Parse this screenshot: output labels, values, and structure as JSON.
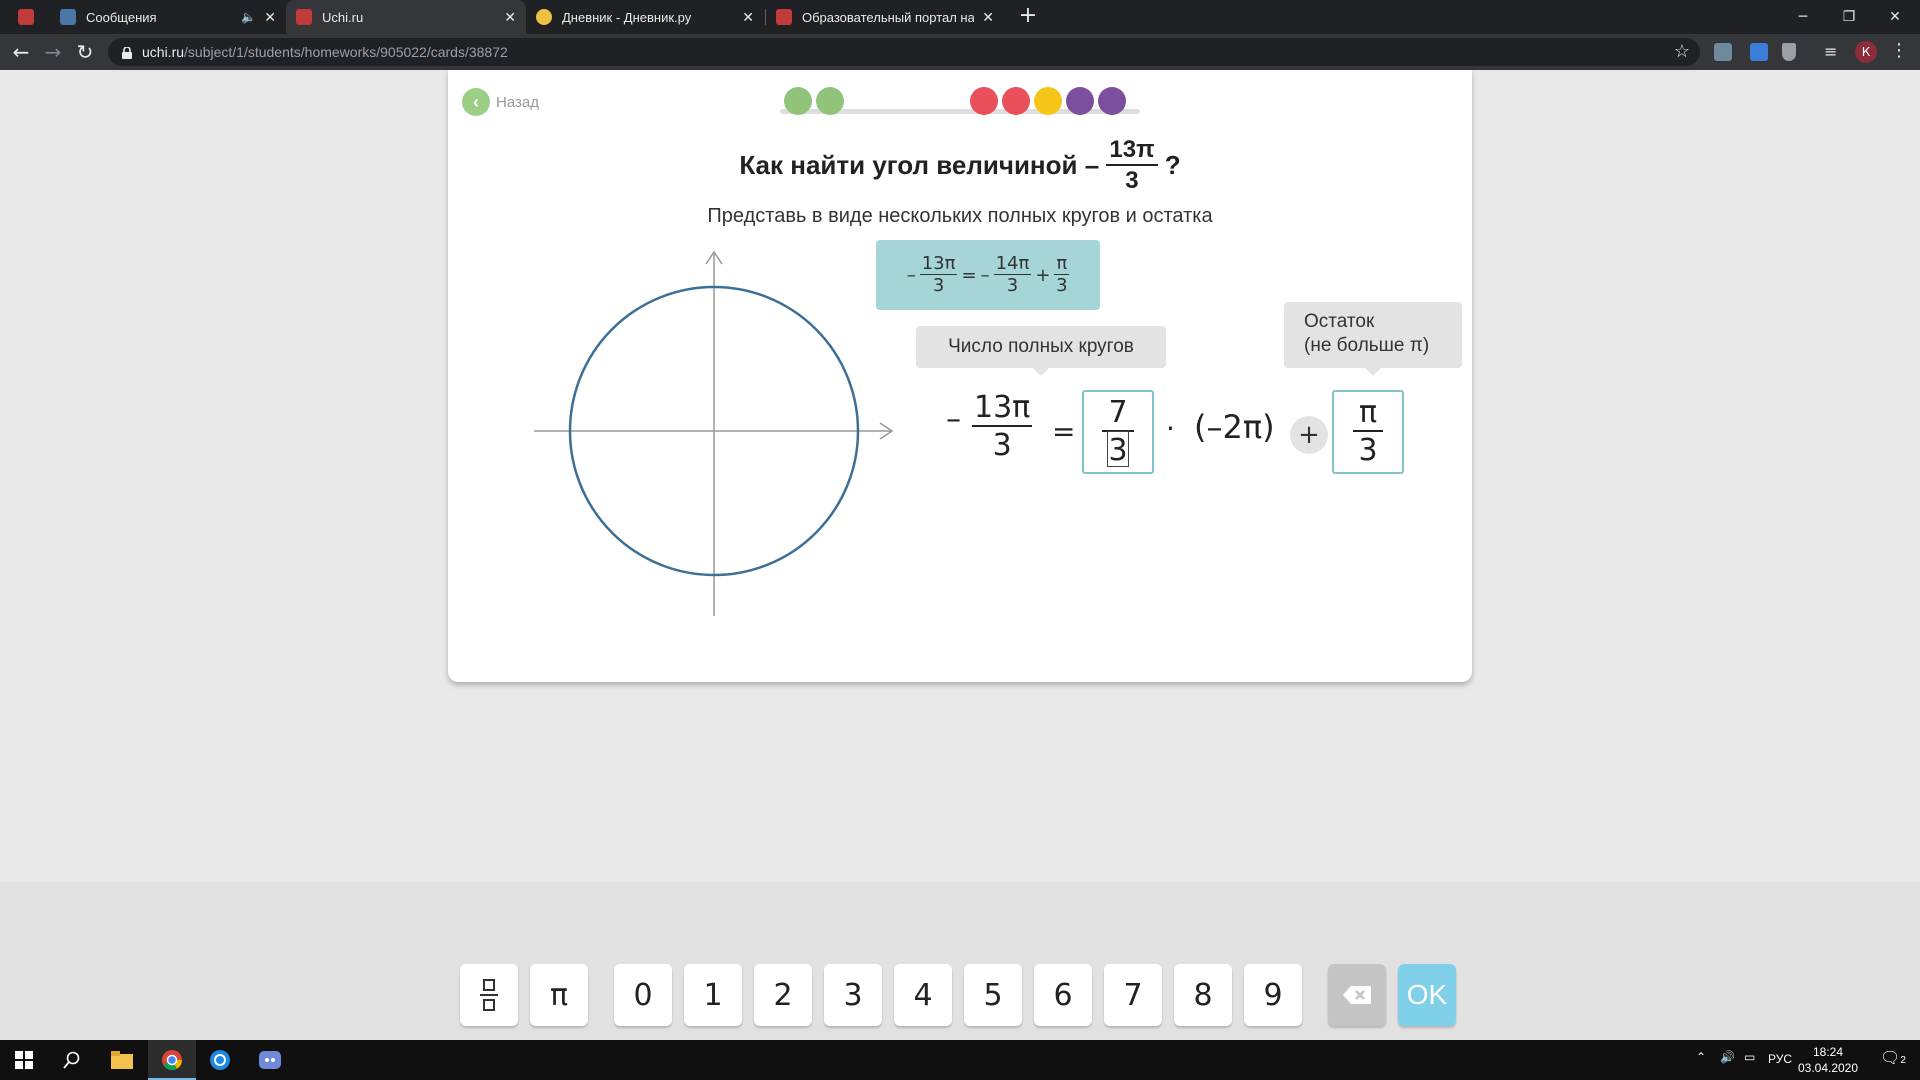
{
  "browser": {
    "tabs": [
      {
        "title": "",
        "favicon_color": "#c23b3b",
        "active": false
      },
      {
        "title": "Сообщения",
        "favicon_color": "#4a76a8",
        "active": false,
        "audio_icon": "speaker-icon"
      },
      {
        "title": "Uchi.ru",
        "favicon_color": "#c23b3b",
        "active": true
      },
      {
        "title": "Дневник - Дневник.ру",
        "favicon_color": "#f0c040",
        "active": false
      },
      {
        "title": "Образовательный портал на ба",
        "favicon_color": "#c23b3b",
        "active": false
      }
    ],
    "url_host": "uchi.ru",
    "url_path": "/subject/1/students/homeworks/905022/cards/38872",
    "profile_initial": "К"
  },
  "page": {
    "back_label": "Назад",
    "progress_dots": [
      "#8fc47a",
      "#8fc47a",
      "#e8505b",
      "#e8505b",
      "#f5c518",
      "#7b4f9d",
      "#7b4f9d"
    ],
    "title_prefix": "Как найти угол величиной –",
    "title_num": "13π",
    "title_den": "3",
    "title_suffix": "?",
    "subtitle": "Представь в виде нескольких полных кругов и остатка",
    "hint": {
      "minus1": "–",
      "f1_num": "13π",
      "f1_den": "3",
      "eq": "=",
      "minus2": "–",
      "f2_num": "14π",
      "f2_den": "3",
      "plus": "+",
      "f3_num": "π",
      "f3_den": "3"
    },
    "bubble_full_circles": "Число полных кругов",
    "bubble_remainder_line1": "Остаток",
    "bubble_remainder_line2": "(не больше π)",
    "equation": {
      "minus": "–",
      "lhs_num": "13π",
      "lhs_den": "3",
      "equals": "=",
      "answer1_num": "7",
      "answer1_den": "3",
      "dot": "·",
      "paren": "(–2π)",
      "plus": "+",
      "answer2_num": "π",
      "answer2_den": "3"
    },
    "circle_color": "#3d6f96"
  },
  "keypad": {
    "pi": "π",
    "digits": [
      "0",
      "1",
      "2",
      "3",
      "4",
      "5",
      "6",
      "7",
      "8",
      "9"
    ],
    "ok": "OK"
  },
  "taskbar": {
    "lang": "РУС",
    "time": "18:24",
    "date": "03.04.2020",
    "notifications": "2"
  }
}
